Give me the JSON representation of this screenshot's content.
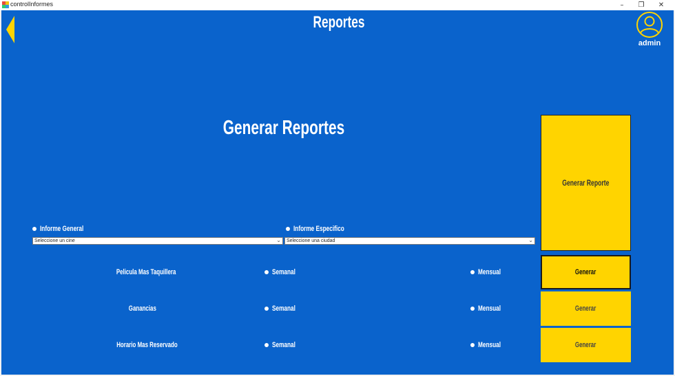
{
  "window": {
    "title": "controlInformes",
    "minimize": "–",
    "maximize": "❐",
    "close": "✕"
  },
  "header": {
    "title": "Reportes",
    "user": "admin",
    "colors": {
      "background": "#0a63cc",
      "accent": "#ffd400"
    }
  },
  "section": {
    "title": "Generar Reportes",
    "generate_report_label": "Generar Reporte"
  },
  "options": {
    "general": {
      "label": "Informe General",
      "select_value": "Seleccione un cine"
    },
    "specific": {
      "label": "Informe Especifico",
      "select_value": "Seleccione una ciudad"
    }
  },
  "rows": [
    {
      "label": "Pelicula Mas Taquillera",
      "weekly": "Semanal",
      "monthly": "Mensual",
      "button": "Generar"
    },
    {
      "label": "Ganancias",
      "weekly": "Semanal",
      "monthly": "Mensual",
      "button": "Generar"
    },
    {
      "label": "Horario Mas Reservado",
      "weekly": "Semanal",
      "monthly": "Mensual",
      "button": "Generar"
    }
  ]
}
